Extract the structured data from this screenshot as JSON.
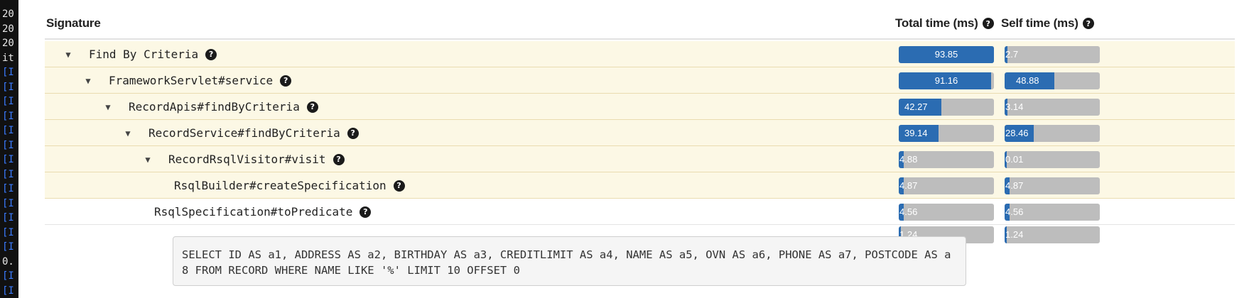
{
  "header": {
    "signature_label": "Signature",
    "total_label": "Total time (ms)",
    "self_label": "Self time (ms)"
  },
  "terminal_lines": [
    "20",
    "20",
    "20",
    "it",
    "[I",
    "[I",
    "[I",
    "[I",
    "[I",
    "[I",
    "[I",
    "[I",
    "[I",
    "[I",
    "[I",
    "[I",
    "[I",
    "0.",
    "[I",
    "[I"
  ],
  "rows": [
    {
      "label": "Find By Criteria",
      "expanded": true,
      "total": "93.85",
      "total_frac": 1.0,
      "self": "2.7",
      "self_frac": 0.03
    },
    {
      "label": "FrameworkServlet#service",
      "expanded": true,
      "total": "91.16",
      "total_frac": 0.97,
      "self": "48.88",
      "self_frac": 0.52
    },
    {
      "label": "RecordApis#findByCriteria",
      "expanded": true,
      "total": "42.27",
      "total_frac": 0.45,
      "self": "3.14",
      "self_frac": 0.033
    },
    {
      "label": "RecordService#findByCriteria",
      "expanded": true,
      "total": "39.14",
      "total_frac": 0.417,
      "self": "28.46",
      "self_frac": 0.303
    },
    {
      "label": "RecordRsqlVisitor#visit",
      "expanded": true,
      "total": "4.88",
      "total_frac": 0.052,
      "self": "0.01",
      "self_frac": 0.0001
    },
    {
      "label": "RsqlBuilder#createSpecification",
      "expanded": false,
      "total": "4.87",
      "total_frac": 0.052,
      "self": "4.87",
      "self_frac": 0.052
    },
    {
      "label": "RsqlSpecification#toPredicate",
      "expanded": false,
      "total": "4.56",
      "total_frac": 0.049,
      "self": "4.56",
      "self_frac": 0.049
    }
  ],
  "sql": {
    "total": "1.24",
    "total_frac": 0.013,
    "self": "1.24",
    "self_frac": 0.013,
    "text": "SELECT ID AS a1, ADDRESS AS a2, BIRTHDAY AS a3, CREDITLIMIT AS a4, NAME AS a5, OVN AS a6, PHONE AS a7, POSTCODE AS a8 FROM RECORD WHERE NAME LIKE '%' LIMIT 10 OFFSET 0"
  },
  "icons": {
    "expand": "caret-down-icon",
    "help": "question-circle-icon"
  },
  "colors": {
    "bar_fill": "#2b6cb2",
    "bar_bg": "#bdbdbd",
    "row_highlight": "#fcf8e5"
  }
}
